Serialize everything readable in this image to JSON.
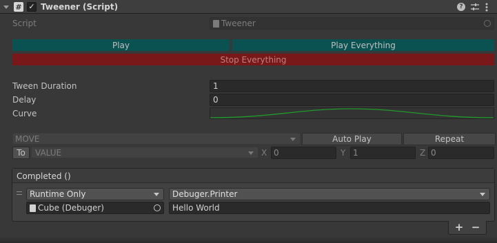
{
  "header": {
    "title": "Tweener (Script)",
    "icons": [
      "foldout-arrow-icon",
      "script-hash-icon",
      "checkbox-check-icon",
      "help-icon",
      "preset-sliders-icon",
      "kebab-menu-icon"
    ]
  },
  "script_row": {
    "label": "Script",
    "value": "Tweener"
  },
  "buttons": {
    "play": "Play",
    "play_everything": "Play Everything",
    "stop_everything": "Stop Everything"
  },
  "tween_duration": {
    "label": "Tween Duration",
    "value": "1"
  },
  "delay": {
    "label": "Delay",
    "value": "0"
  },
  "curve": {
    "label": "Curve",
    "curve_color": "#1f9b2a"
  },
  "mode_row": {
    "mode": "MOVE",
    "auto_play": "Auto Play",
    "repeat": "Repeat"
  },
  "value_row": {
    "to": "To",
    "value": "VALUE",
    "x_label": "X",
    "x": "0",
    "y_label": "Y",
    "y": "1",
    "z_label": "Z",
    "z": "0"
  },
  "event": {
    "title": "Completed ()",
    "runtime": "Runtime Only",
    "function": "Debuger.Printer",
    "object": "Cube (Debuger)",
    "argument": "Hello World",
    "add": "+",
    "remove": "−"
  },
  "colors": {
    "play": "#0a5151",
    "stop": "#781818",
    "background": "#383838"
  }
}
